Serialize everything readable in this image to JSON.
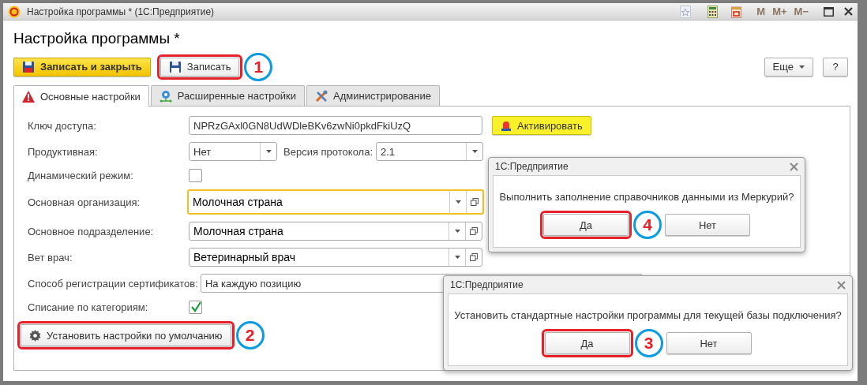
{
  "window": {
    "title": "Настройка программы *  (1С:Предприятие)",
    "memory_buttons": [
      "M",
      "M+",
      "M−"
    ]
  },
  "form": {
    "title": "Настройка программы *",
    "buttons": [
      {
        "label": "Записать и закрыть",
        "kind": "primary"
      },
      {
        "label": "Записать",
        "kind": "default",
        "callout": "1"
      }
    ],
    "more": "Еще",
    "help": "?"
  },
  "tabs": [
    {
      "label": "Основные настройки",
      "selected": true,
      "kind": "warning"
    },
    {
      "label": "Расширенные настройки",
      "selected": false,
      "kind": "network"
    },
    {
      "label": "Администрирование",
      "selected": false,
      "kind": "tools"
    }
  ],
  "fields": [
    {
      "kind": "text",
      "label": "Ключ доступа:",
      "value": "NPRzGAxl0GN8UdWDleBKv6zwNi0pkdFkiUzQ",
      "button": "Активировать"
    },
    {
      "kind": "select_pair",
      "label": "Продуктивная:",
      "value": "Нет",
      "label_2": "Версия протокола:",
      "value_2": "2.1"
    },
    {
      "kind": "checkbox",
      "label": "Динамический режим:",
      "checked": false
    },
    {
      "kind": "reference",
      "label": "Основная организация:",
      "value": "Молочная страна",
      "focused": true
    },
    {
      "kind": "reference",
      "label": "Основное подразделение:",
      "value": "Молочная страна",
      "focused": false
    },
    {
      "kind": "reference",
      "label": "Вет врач:",
      "value": "Ветеринарный врач",
      "focused": false
    },
    {
      "kind": "wide",
      "label": "Способ регистрации сертификатов:",
      "value": "На каждую позицию"
    },
    {
      "kind": "checkbox",
      "label": "Списание по категориям:",
      "checked": true
    }
  ],
  "defaults_button": {
    "label": "Установить настройки по умолчанию",
    "callout": "2"
  },
  "dialogs": [
    {
      "title": "1С:Предприятие",
      "message": "Выполнить заполнение справочников данными из Меркурий?",
      "buttons": [
        {
          "label": "Да",
          "callout": "4"
        },
        {
          "label": "Нет"
        }
      ]
    },
    {
      "title": "1С:Предприятие",
      "message": "Установить стандартные настройки программы для текущей базы подключения?",
      "buttons": [
        {
          "label": "Да",
          "callout": "3"
        },
        {
          "label": "Нет"
        }
      ]
    }
  ]
}
